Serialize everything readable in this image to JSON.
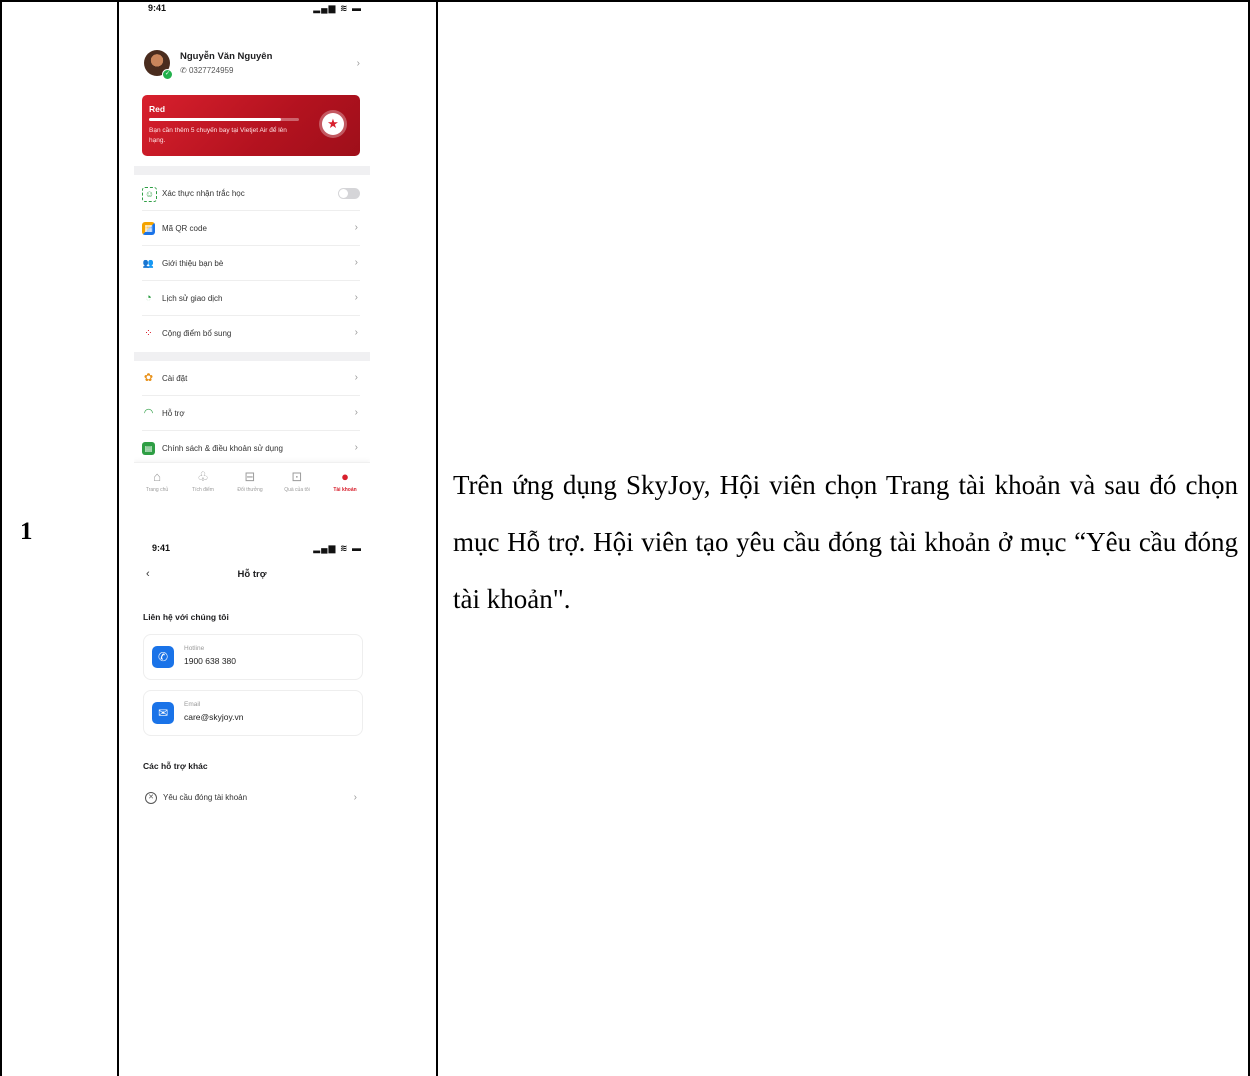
{
  "row": {
    "number": "1",
    "description": "Trên ứng dụng SkyJoy, Hội viên chọn Trang tài khoản và sau đó chọn mục Hỗ trợ. Hội viên tạo yêu cầu đóng tài khoản ở mục “Yêu cầu đóng tài khoản\"."
  },
  "screen1": {
    "status_time": "9:41",
    "status_icons": "▂▄▆ ≋ ▬",
    "profile": {
      "name": "Nguyễn Văn Nguyên",
      "phone": "0327724959"
    },
    "tier_card": {
      "tier": "Red",
      "progress": 0.88,
      "message": "Bạn cần thêm 5 chuyến bay tại Vietjet Air để lên hạng."
    },
    "menu": [
      {
        "label": "Xác thực nhận trắc học",
        "icon": "face-scan-icon",
        "toggle": true
      },
      {
        "label": "Mã QR code",
        "icon": "qr-code-icon"
      },
      {
        "label": "Giới thiệu bạn bè",
        "icon": "friends-icon"
      },
      {
        "label": "Lịch sử giao dịch",
        "icon": "history-icon"
      },
      {
        "label": "Cộng điểm bổ sung",
        "icon": "add-points-icon"
      }
    ],
    "menu2": [
      {
        "label": "Cài đặt",
        "icon": "settings-icon"
      },
      {
        "label": "Hỗ trợ",
        "icon": "support-icon"
      },
      {
        "label": "Chính sách & điều khoản sử dụng",
        "icon": "policy-icon"
      }
    ],
    "nav": [
      {
        "label": "Trang chủ",
        "icon": "home-icon"
      },
      {
        "label": "Tích điểm",
        "icon": "earn-points-icon"
      },
      {
        "label": "Đổi thưởng",
        "icon": "redeem-icon"
      },
      {
        "label": "Quà của tôi",
        "icon": "my-gifts-icon"
      },
      {
        "label": "Tài khoản",
        "icon": "account-icon",
        "active": true
      }
    ]
  },
  "screen2": {
    "status_time": "9:41",
    "status_icons": "▂▄▆ ≋ ▬",
    "title": "Hỗ trợ",
    "contact_section": "Liên hệ với chúng tôi",
    "hotline": {
      "label": "Hotline",
      "value": "1900 638 380"
    },
    "email": {
      "label": "Email",
      "value": "care@skyjoy.vn"
    },
    "other_section": "Các hỗ trợ khác",
    "close_account": "Yêu cầu đóng tài khoản"
  },
  "colors": {
    "brand_red": "#d8202d",
    "accent_blue": "#1a73e8"
  }
}
